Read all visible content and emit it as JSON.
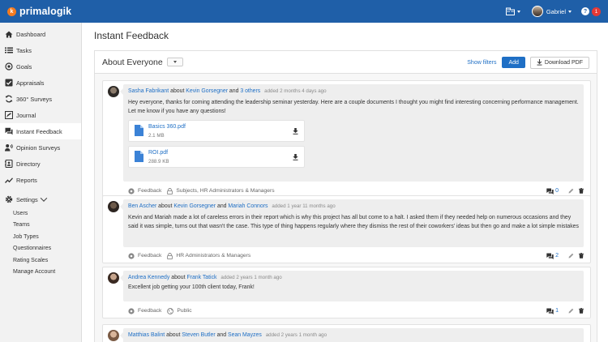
{
  "app": {
    "brand": "primalogik"
  },
  "topbar": {
    "user_name": "Gabriel",
    "help_label": "?",
    "notification_count": "1",
    "logo_letter": "k"
  },
  "sidebar": {
    "items": [
      {
        "label": "Dashboard",
        "icon": "home-icon"
      },
      {
        "label": "Tasks",
        "icon": "list-icon"
      },
      {
        "label": "Goals",
        "icon": "target-icon"
      },
      {
        "label": "Appraisals",
        "icon": "check-box-icon"
      },
      {
        "label": "360° Surveys",
        "icon": "cycle-icon"
      },
      {
        "label": "Journal",
        "icon": "journal-icon"
      },
      {
        "label": "Instant Feedback",
        "icon": "chat-icon",
        "active": true
      },
      {
        "label": "Opinion Surveys",
        "icon": "megaphone-icon"
      },
      {
        "label": "Directory",
        "icon": "directory-icon"
      },
      {
        "label": "Reports",
        "icon": "chart-icon"
      }
    ],
    "settings_label": "Settings",
    "sub_items": [
      "Users",
      "Teams",
      "Job Types",
      "Questionnaires",
      "Rating Scales",
      "Manage Account"
    ]
  },
  "main": {
    "page_title": "Instant Feedback",
    "panel_title": "About Everyone",
    "show_filters": "Show filters",
    "add_label": "Add",
    "download_pdf": "Download PDF"
  },
  "feed": [
    {
      "author": "Sasha Fabrikant",
      "about_word": "about",
      "subject": "Kevin Gorsegner",
      "and_word": "and",
      "others": "3 others",
      "date": "added 2 months 4 days ago",
      "message": "Hey everyone, thanks for coming attending the leadership seminar yesterday. Here are a couple documents I thought you might find interesting concerning performance management. Let me know if you have any questions!",
      "attachments": [
        {
          "name": "Basics 360.pdf",
          "size": "2.1 MB"
        },
        {
          "name": "ROI.pdf",
          "size": "288.9 KB"
        }
      ],
      "type": "Feedback",
      "visibility": "Subjects, HR Administrators & Managers",
      "comments": "0"
    },
    {
      "author": "Ben Ascher",
      "about_word": "about",
      "subject": "Kevin Gorsegner",
      "and_word": "and",
      "others": "Mariah Connors",
      "date": "added 1 year 11 months ago",
      "message": "Kevin and Mariah made a lot of careless errors in their report which is why this project has all but come to a halt. I asked them if they needed help on numerous occasions and they said it was simple, turns out that wasn't the case. This type of thing happens regularly where they dismiss the rest of their coworkers' ideas but then go and make a lot simple mistakes",
      "type": "Feedback",
      "visibility": "HR Administrators & Managers",
      "comments": "2"
    },
    {
      "author": "Andrea Kennedy",
      "about_word": "about",
      "subject": "Frank Tatick",
      "date": "added 2 years 1 month ago",
      "message": "Excellent job getting your 100th client today, Frank!",
      "type": "Feedback",
      "visibility": "Public",
      "comments": "1"
    },
    {
      "author": "Matthias Balint",
      "about_word": "about",
      "subject": "Steven Butler",
      "and_word": "and",
      "others": "Sean Mayzes",
      "date": "added 2 years 1 month ago"
    }
  ],
  "colors": {
    "topbar": "#1f5fa8",
    "link": "#1f6fc5",
    "accent_logo": "#f47b20",
    "badge": "#e53935"
  }
}
